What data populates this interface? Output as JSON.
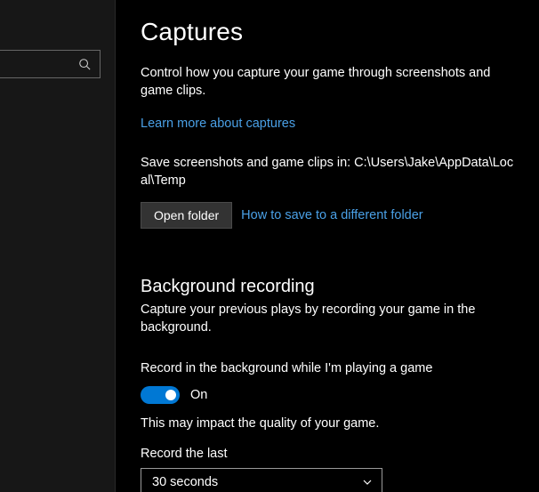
{
  "page": {
    "title": "Captures",
    "intro": "Control how you capture your game through screenshots and game clips.",
    "learn_more": "Learn more about captures",
    "save_path": "Save screenshots and game clips in: C:\\Users\\Jake\\AppData\\Local\\Temp",
    "open_folder": "Open folder",
    "how_to_save": "How to save to a different folder"
  },
  "bg": {
    "heading": "Background recording",
    "desc": "Capture your previous plays by recording your game in the background.",
    "toggle_label": "Record in the background while I'm playing a game",
    "toggle_state": "On",
    "impact": "This may impact the quality of your game.",
    "record_last_label": "Record the last",
    "record_last_value": "30 seconds"
  }
}
